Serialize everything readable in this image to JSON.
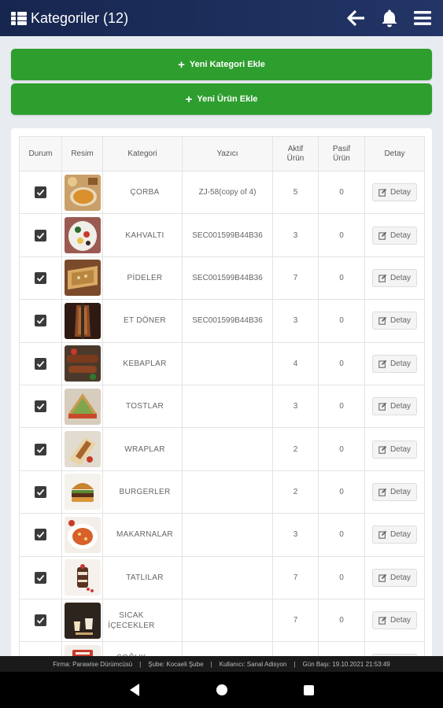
{
  "header": {
    "title": "Kategoriler (12)"
  },
  "actions": {
    "new_category": "Yeni Kategori Ekle",
    "new_product": "Yeni Ürün Ekle"
  },
  "table": {
    "columns": [
      "Durum",
      "Resim",
      "Kategori",
      "Yazıcı",
      "Aktif Ürün",
      "Pasif Ürün",
      "Detay"
    ],
    "detail_label": "Detay",
    "rows": [
      {
        "name": "ÇORBA",
        "printer": "ZJ-58(copy of 4)",
        "active": "5",
        "passive": "0",
        "checked": true,
        "thumb": "soup"
      },
      {
        "name": "KAHVALTI",
        "printer": "SEC001599B44B36",
        "active": "3",
        "passive": "0",
        "checked": true,
        "thumb": "breakfast"
      },
      {
        "name": "PİDELER",
        "printer": "SEC001599B44B36",
        "active": "7",
        "passive": "0",
        "checked": true,
        "thumb": "pide"
      },
      {
        "name": "ET DÖNER",
        "printer": "SEC001599B44B36",
        "active": "3",
        "passive": "0",
        "checked": true,
        "thumb": "doner"
      },
      {
        "name": "KEBAPLAR",
        "printer": "",
        "active": "4",
        "passive": "0",
        "checked": true,
        "thumb": "kebab"
      },
      {
        "name": "TOSTLAR",
        "printer": "",
        "active": "3",
        "passive": "0",
        "checked": true,
        "thumb": "toast"
      },
      {
        "name": "WRAPLAR",
        "printer": "",
        "active": "2",
        "passive": "0",
        "checked": true,
        "thumb": "wrap"
      },
      {
        "name": "BURGERLER",
        "printer": "",
        "active": "2",
        "passive": "0",
        "checked": true,
        "thumb": "burger"
      },
      {
        "name": "MAKARNALAR",
        "printer": "",
        "active": "3",
        "passive": "0",
        "checked": true,
        "thumb": "pasta"
      },
      {
        "name": "TATLILAR",
        "printer": "",
        "active": "7",
        "passive": "0",
        "checked": true,
        "thumb": "dessert"
      },
      {
        "name": "SICAK İÇECEKLER",
        "printer": "",
        "active": "7",
        "passive": "0",
        "checked": true,
        "thumb": "hotdrink"
      },
      {
        "name": "SOĞUK İÇECEKLER",
        "printer": "",
        "active": "",
        "passive": "",
        "checked": true,
        "thumb": "colddrink"
      }
    ]
  },
  "status_bar": {
    "firma": "Firma: Parawise Dürümcüsü",
    "sube": "Şube: Kocaeli Şube",
    "kullanici": "Kullanıcı: Sanal Adisyon",
    "gun_basi": "Gün Başı: 19.10.2021 21:53:49",
    "separator": "|"
  },
  "colors": {
    "header": "#1e2f5e",
    "green": "#2e9e2e"
  },
  "icons": {
    "menu": "grid-list-icon",
    "back": "arrow-left-icon",
    "notify": "bell-icon",
    "hamburger": "hamburger-icon"
  }
}
